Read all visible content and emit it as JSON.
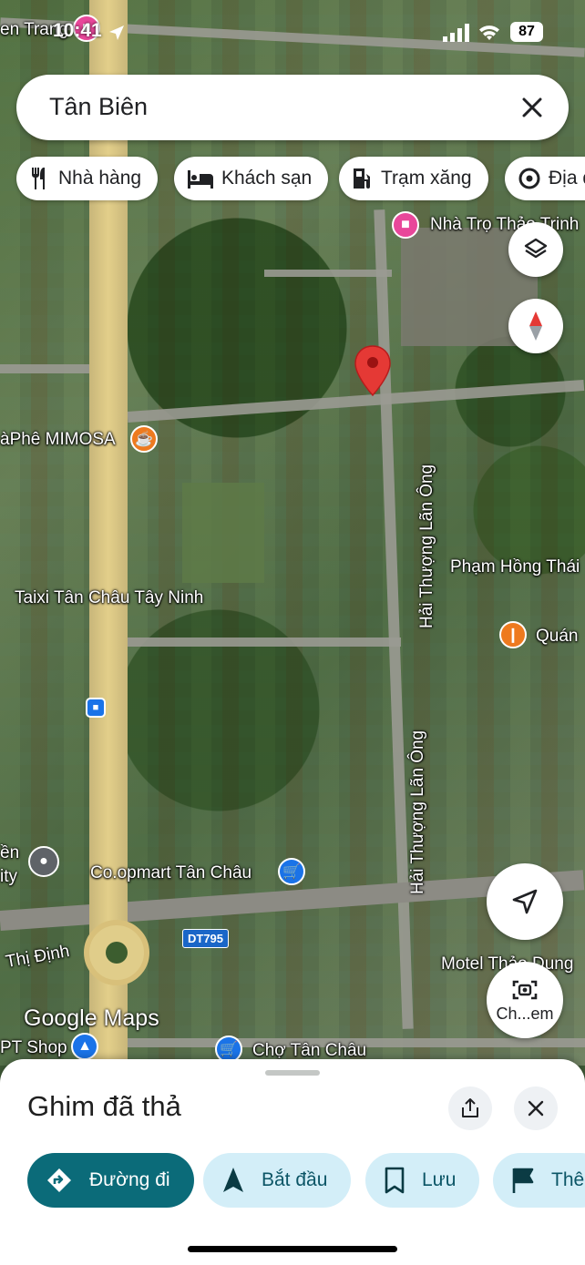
{
  "status_bar": {
    "time": "10:41",
    "battery": "87",
    "partial_label": "en Trang"
  },
  "search": {
    "query": "Tân Biên"
  },
  "chips": [
    {
      "label": "Nhà hàng",
      "icon": "restaurant-icon"
    },
    {
      "label": "Khách sạn",
      "icon": "hotel-icon"
    },
    {
      "label": "Trạm xăng",
      "icon": "gas-station-icon"
    },
    {
      "label": "Địa đ",
      "icon": "attraction-icon"
    }
  ],
  "map_labels": {
    "nha_tro": "Nhà Trọ Thảo Trinh",
    "caphe": "àPhê MIMOSA",
    "pham_hong_thai": "Phạm Hồng Thái",
    "taixi": "Taixi Tân Châu Tây Ninh",
    "quan": "Quán",
    "hai_thuong_1": "Hải Thượng Lãn Ông",
    "hai_thuong_2": "Hải Thượng Lãn Ông",
    "coopmart": "Co.opmart Tân Châu",
    "thi_dinh": "Thị Định",
    "tuyen": "ền",
    "ity": "ity",
    "road_shield": "DT795",
    "motel": "Motel Thảo Dung",
    "pt_shop": "PT Shop",
    "cho": "Chợ Tân Châu",
    "logo": "Google Maps"
  },
  "map_buttons": {
    "camera_label": "Ch...em"
  },
  "sheet": {
    "title": "Ghim đã thả",
    "actions": [
      {
        "label": "Đường đi",
        "icon": "directions-icon"
      },
      {
        "label": "Bắt đầu",
        "icon": "navigation-arrow-icon"
      },
      {
        "label": "Lưu",
        "icon": "bookmark-icon"
      },
      {
        "label": "Thê",
        "icon": "flag-icon"
      }
    ]
  },
  "colors": {
    "primary": "#0b6b79",
    "secondary_chip": "#d3eef8",
    "pin": "#e53935",
    "highway": "#e3cf8a"
  }
}
